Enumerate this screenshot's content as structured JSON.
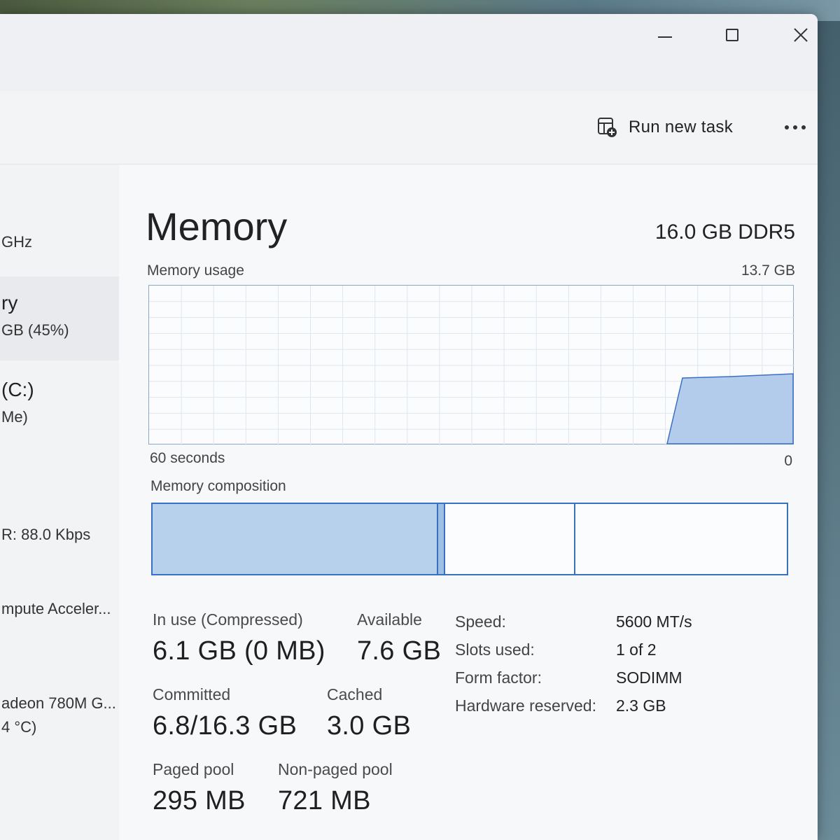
{
  "window_controls": {
    "minimize": "minimize",
    "maximize": "maximize",
    "close": "close"
  },
  "toolbar": {
    "run_new_task_label": "Run new task",
    "more_options": "more-options"
  },
  "sidebar": {
    "items": [
      {
        "title": "",
        "detail": "GHz"
      },
      {
        "title": "ry",
        "detail": "GB (45%)"
      },
      {
        "title": "(C:)",
        "detail": "Me)"
      },
      {
        "title": "",
        "detail": "R: 88.0 Kbps"
      },
      {
        "title": "",
        "detail": "mpute Acceler..."
      },
      {
        "title": "",
        "detail": "adeon 780M G..."
      },
      {
        "title": "",
        "detail": "4 °C)"
      }
    ]
  },
  "memory": {
    "title": "Memory",
    "spec": "16.0 GB DDR5",
    "usage_label": "Memory usage",
    "usage_max": "13.7 GB",
    "time_span": "60 seconds",
    "axis_zero": "0",
    "composition_label": "Memory composition",
    "in_use_label": "In use (Compressed)",
    "in_use_value": "6.1 GB (0 MB)",
    "available_label": "Available",
    "available_value": "7.6 GB",
    "committed_label": "Committed",
    "committed_value": "6.8/16.3 GB",
    "cached_label": "Cached",
    "cached_value": "3.0 GB",
    "paged_pool_label": "Paged pool",
    "paged_pool_value": "295 MB",
    "nonpaged_pool_label": "Non-paged pool",
    "nonpaged_pool_value": "721 MB",
    "specs": [
      {
        "key": "Speed:",
        "value": "5600 MT/s"
      },
      {
        "key": "Slots used:",
        "value": "1 of 2"
      },
      {
        "key": "Form factor:",
        "value": "SODIMM"
      },
      {
        "key": "Hardware reserved:",
        "value": "2.3 GB"
      }
    ]
  },
  "colors": {
    "graph_fill": "#b3cceb",
    "graph_line": "#3a6fc4",
    "grid": "#dfe6ee"
  }
}
